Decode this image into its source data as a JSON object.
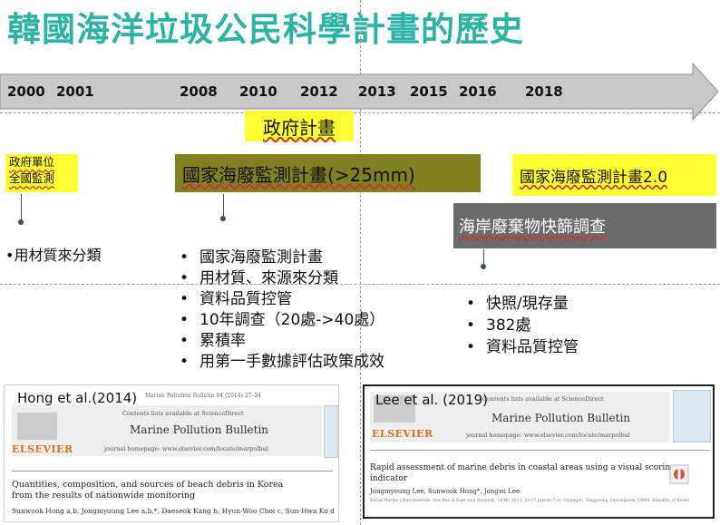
{
  "title": "韓國海洋垃圾公民科學計畫的歷史",
  "timeline": {
    "years": [
      "2000",
      "2001",
      "2008",
      "2010",
      "2012",
      "2013",
      "2015",
      "2016",
      "2018"
    ]
  },
  "boxes": {
    "gov_plan": "政府計畫",
    "gov_unit_line1": "政府單位",
    "gov_unit_line2": "全國監測",
    "national_monitoring": "國家海廢監測計畫(>25mm)",
    "national_monitoring_2": "國家海廢監測計畫2.0",
    "coastal_screening": "海岸廢棄物快篩調查"
  },
  "left_note": "•用材質來分類",
  "middle_list": [
    "國家海廢監測計畫",
    "用材質、來源來分類",
    "資料品質控管",
    "10年調查（20處->40處）",
    "累積率",
    "用第一手數據評估政策成效"
  ],
  "right_list": [
    "快照/現存量",
    "382處",
    "資料品質控管"
  ],
  "paper1": {
    "caption": "Hong et al.(2014)",
    "meta": "Marine Pollution Bulletin 84 (2014) 27–34",
    "contents": "Contents lists available at ScienceDirect",
    "journal": "Marine Pollution Bulletin",
    "homepage": "journal homepage: www.elsevier.com/locate/marpolbul",
    "publisher": "ELSEVIER",
    "article_title_line1": "Quantities, composition, and sources of beach debris in Korea",
    "article_title_line2": "from the results of nationwide monitoring",
    "authors": "Sunwook Hong a,b, Jongmyoung Lee a,b,*, Daeseok Kang b, Hyun-Woo Choi c, Sun-Hwa Ko d"
  },
  "paper2": {
    "caption": "Lee et al. (2019)",
    "contents": "Contents lists available at ScienceDirect",
    "journal": "Marine Pollution Bulletin",
    "homepage": "journal homepage: www.elsevier.com/locate/marpolbul",
    "publisher": "ELSEVIER",
    "article_title_line1": "Rapid assessment of marine debris in coastal areas using a visual scoring",
    "article_title_line2": "indicator",
    "authors": "Jongmyoung Lee, Sunwook Hong*, Jongsu Lee",
    "affiliation": "Korea Marine Litter Institute, Our Sea of East Asia Network, 18 RC 2013, 23-17 Jukrim 7 ro, Gwangdo, Tongyeong, Gyeongnam 53044, Republic of Korea"
  },
  "colors": {
    "title": "#2bb3a6",
    "highlight_yellow": "#ffff33",
    "olive": "#808020",
    "gray_box": "#6b6b6b",
    "arrow_fill": "#c9c9c9",
    "connector": "#3b4e6e"
  }
}
